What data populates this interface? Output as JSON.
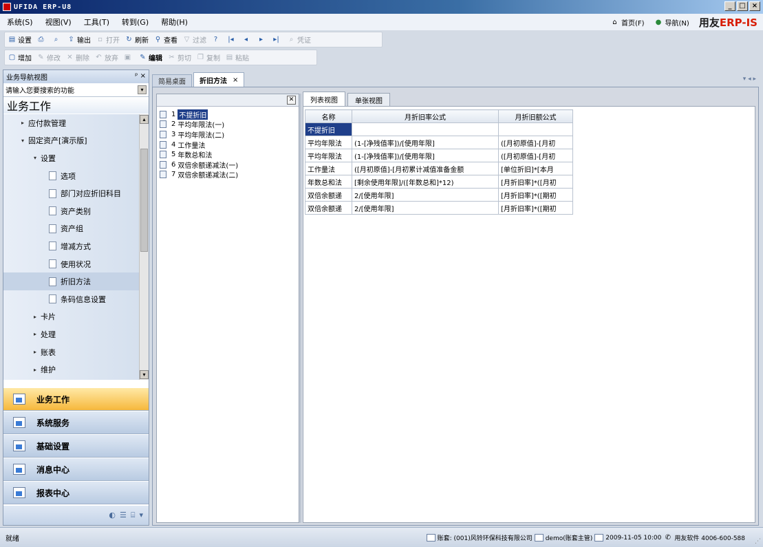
{
  "window": {
    "title": "UFIDA ERP-U8",
    "controls": [
      "_",
      "□",
      "×"
    ]
  },
  "menu": {
    "items": [
      "系统(S)",
      "视图(V)",
      "工具(T)",
      "转到(G)",
      "帮助(H)"
    ],
    "home": "首页(F)",
    "nav": "导航(N)",
    "brand_prefix": "用友",
    "brand_erp": "ERP",
    "brand_suffix": "-IS"
  },
  "toolbar1": [
    {
      "label": "设置",
      "icon": "▤",
      "disabled": false
    },
    {
      "label": "",
      "icon": "⎙",
      "disabled": false
    },
    {
      "label": "",
      "icon": "⌕",
      "disabled": false
    },
    {
      "label": "输出",
      "icon": "⇪",
      "disabled": false
    },
    {
      "label": "打开",
      "icon": "▫",
      "disabled": true
    },
    {
      "label": "刷新",
      "icon": "↻",
      "disabled": false
    },
    {
      "label": "查看",
      "icon": "⚲",
      "disabled": false
    },
    {
      "label": "过滤",
      "icon": "▽",
      "disabled": true
    },
    {
      "label": "",
      "icon": "?",
      "disabled": false
    },
    {
      "label": "",
      "icon": "|◂",
      "disabled": false
    },
    {
      "label": "",
      "icon": "◂",
      "disabled": false
    },
    {
      "label": "",
      "icon": "▸",
      "disabled": false
    },
    {
      "label": "",
      "icon": "▸|",
      "disabled": false
    },
    {
      "label": "凭证",
      "icon": "⌕",
      "disabled": true
    }
  ],
  "toolbar2": [
    {
      "label": "增加",
      "icon": "▢",
      "disabled": false,
      "bold": false
    },
    {
      "label": "修改",
      "icon": "✎",
      "disabled": true,
      "bold": false
    },
    {
      "label": "删除",
      "icon": "✕",
      "disabled": true,
      "bold": false
    },
    {
      "label": "放弃",
      "icon": "↶",
      "disabled": true,
      "bold": false
    },
    {
      "label": "",
      "icon": "▣",
      "disabled": true,
      "bold": false
    },
    {
      "label": "编辑",
      "icon": "✎",
      "disabled": false,
      "bold": true
    },
    {
      "label": "剪切",
      "icon": "✂",
      "disabled": true,
      "bold": false
    },
    {
      "label": "复制",
      "icon": "❐",
      "disabled": true,
      "bold": false
    },
    {
      "label": "粘贴",
      "icon": "▤",
      "disabled": true,
      "bold": false
    }
  ],
  "left_panel": {
    "header": "业务导航视图",
    "pin": "ᵖ ×",
    "search_placeholder": "请输入您要搜索的功能",
    "title": "业务工作",
    "tree": [
      {
        "label": "应付款管理",
        "level": 1,
        "arrow": "▸",
        "type": "folder"
      },
      {
        "label": "固定资产[演示版]",
        "level": 1,
        "arrow": "▾",
        "type": "folder"
      },
      {
        "label": "设置",
        "level": 2,
        "arrow": "▾",
        "type": "folder"
      },
      {
        "label": "选项",
        "level": 3,
        "arrow": "",
        "type": "doc"
      },
      {
        "label": "部门对应折旧科目",
        "level": 3,
        "arrow": "",
        "type": "doc"
      },
      {
        "label": "资产类别",
        "level": 3,
        "arrow": "",
        "type": "doc"
      },
      {
        "label": "资产组",
        "level": 3,
        "arrow": "",
        "type": "doc"
      },
      {
        "label": "增减方式",
        "level": 3,
        "arrow": "",
        "type": "doc"
      },
      {
        "label": "使用状况",
        "level": 3,
        "arrow": "",
        "type": "doc"
      },
      {
        "label": "折旧方法",
        "level": 3,
        "arrow": "",
        "type": "doc",
        "selected": true
      },
      {
        "label": "条码信息设置",
        "level": 3,
        "arrow": "",
        "type": "doc"
      },
      {
        "label": "卡片",
        "level": 2,
        "arrow": "▸",
        "type": "folder"
      },
      {
        "label": "处理",
        "level": 2,
        "arrow": "▸",
        "type": "folder"
      },
      {
        "label": "账表",
        "level": 2,
        "arrow": "▸",
        "type": "folder"
      },
      {
        "label": "维护",
        "level": 2,
        "arrow": "▸",
        "type": "folder"
      }
    ],
    "modules": [
      {
        "label": "业务工作",
        "active": true
      },
      {
        "label": "系统服务",
        "active": false
      },
      {
        "label": "基础设置",
        "active": false
      },
      {
        "label": "消息中心",
        "active": false
      },
      {
        "label": "报表中心",
        "active": false
      }
    ]
  },
  "tabs": [
    {
      "label": "简易桌面",
      "active": false,
      "closable": false
    },
    {
      "label": "折旧方法",
      "active": true,
      "closable": true
    }
  ],
  "tabs_scroll": "▾ ◂ ▸",
  "methods": [
    {
      "num": "1",
      "label": "不提折旧",
      "selected": true
    },
    {
      "num": "2",
      "label": "平均年限法(一)",
      "selected": false
    },
    {
      "num": "3",
      "label": "平均年限法(二)",
      "selected": false
    },
    {
      "num": "4",
      "label": "工作量法",
      "selected": false
    },
    {
      "num": "5",
      "label": "年数总和法",
      "selected": false
    },
    {
      "num": "6",
      "label": "双倍余额递减法(一)",
      "selected": false
    },
    {
      "num": "7",
      "label": "双倍余额递减法(二)",
      "selected": false
    }
  ],
  "view_tabs": [
    {
      "label": "列表视图",
      "active": true
    },
    {
      "label": "单张视图",
      "active": false
    }
  ],
  "grid": {
    "columns": [
      "名称",
      "月折旧率公式",
      "月折旧额公式"
    ],
    "rows": [
      [
        "不提折旧",
        "",
        ""
      ],
      [
        "平均年限法",
        "(1-[净残值率])/[使用年限]",
        "([月初原值]-[月初"
      ],
      [
        "平均年限法",
        "(1-[净残值率])/[使用年限]",
        "([月初原值]-[月初"
      ],
      [
        "工作量法",
        "([月初原值]-[月初累计减值准备金额",
        "[单位折旧]*[本月"
      ],
      [
        "年数总和法",
        "[剩余使用年限]/([年数总和]*12)",
        "[月折旧率]*([月初"
      ],
      [
        "双倍余额递",
        "2/[使用年限]",
        "[月折旧率]*([期初"
      ],
      [
        "双倍余额递",
        "2/[使用年限]",
        "[月折旧率]*([期初"
      ]
    ]
  },
  "status": {
    "left": "就绪",
    "account": "账套: (001)风铃环保科技有限公司",
    "user": "demo(账套主管)",
    "datetime": "2009-11-05 10:00",
    "vendor": "用友软件 4006-600-588"
  }
}
